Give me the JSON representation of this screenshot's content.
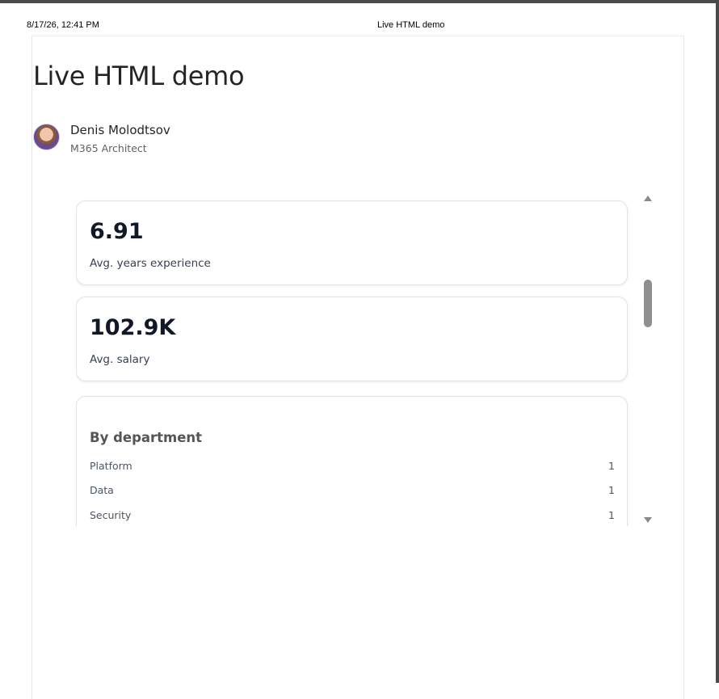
{
  "print_header": {
    "date": "8/17/26, 12:41 PM",
    "title": "Live HTML demo"
  },
  "document": {
    "title": "Live HTML demo",
    "author": {
      "name": "Denis Molodtsov",
      "role": "M365 Architect"
    }
  },
  "cards": {
    "kpi1": {
      "value": "6.91",
      "label": "Avg. years experience"
    },
    "kpi2": {
      "value": "102.9K",
      "label": "Avg. salary"
    },
    "departments": {
      "heading": "By department",
      "rows": [
        {
          "name": "Platform",
          "count": "1"
        },
        {
          "name": "Data",
          "count": "1"
        },
        {
          "name": "Security",
          "count": "1"
        }
      ]
    }
  },
  "icons": {
    "scroll_up": "triangle-up-icon",
    "scroll_down": "triangle-down-icon"
  }
}
